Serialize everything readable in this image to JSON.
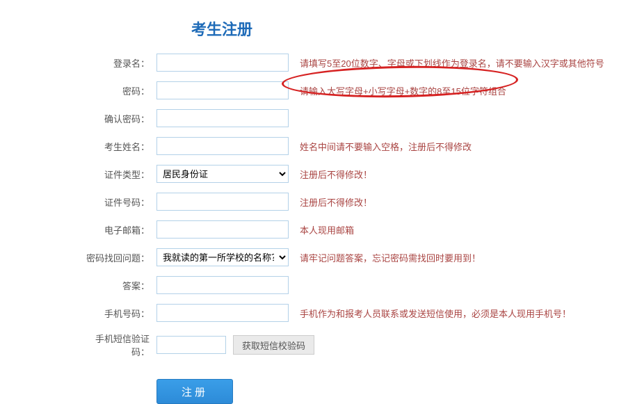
{
  "title": "考生注册",
  "labels": {
    "login_name": "登录名：",
    "password": "密码：",
    "confirm_password": "确认密码：",
    "student_name": "考生姓名：",
    "id_type": "证件类型：",
    "id_number": "证件号码：",
    "email": "电子邮箱：",
    "security_question": "密码找回问题：",
    "answer": "答案：",
    "phone": "手机号码：",
    "sms_code": "手机短信验证码："
  },
  "hints": {
    "login_name": "请填写5至20位数字、字母或下划线作为登录名，请不要输入汉字或其他符号",
    "password": "请输入大写字母+小写字母+数字的8至15位字符组合",
    "student_name": "姓名中间请不要输入空格，注册后不得修改",
    "id_type": "注册后不得修改！",
    "id_number": "注册后不得修改！",
    "email": "本人现用邮箱",
    "security_question": "请牢记问题答案，忘记密码需找回时要用到！",
    "phone": "手机作为和报考人员联系或发送短信使用，必须是本人现用手机号！"
  },
  "selects": {
    "id_type_selected": "居民身份证",
    "question_selected": "我就读的第一所学校的名称？"
  },
  "buttons": {
    "sms": "获取短信校验码",
    "submit": "注册"
  }
}
